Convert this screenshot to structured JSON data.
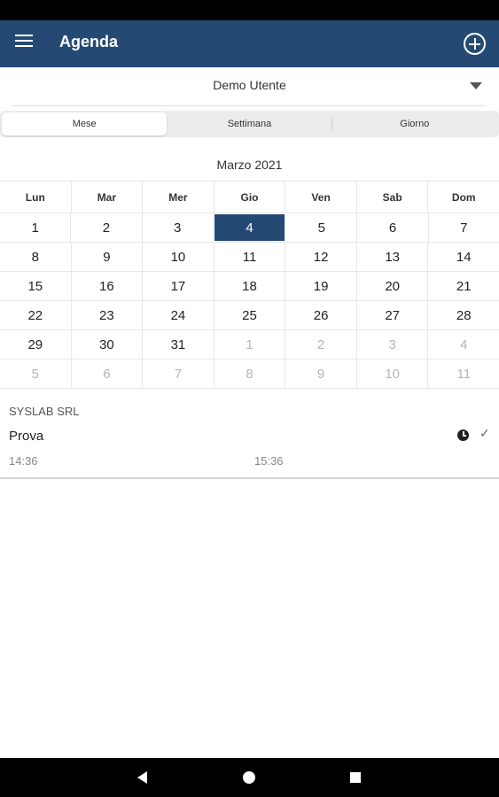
{
  "app": {
    "title": "Agenda",
    "menu_icon": "hamburger-menu-icon",
    "add_icon": "plus-circle-icon"
  },
  "user_selector": {
    "value": "Demo Utente",
    "icon": "triangle-down-icon"
  },
  "view_tabs": [
    {
      "label": "Mese",
      "active": true
    },
    {
      "label": "Settimana",
      "active": false
    },
    {
      "label": "Giorno",
      "active": false
    }
  ],
  "calendar": {
    "month_label": "Marzo 2021",
    "weekdays": [
      "Lun",
      "Mar",
      "Mer",
      "Gio",
      "Ven",
      "Sab",
      "Dom"
    ],
    "weeks": [
      [
        {
          "d": "1",
          "o": false
        },
        {
          "d": "2",
          "o": false
        },
        {
          "d": "3",
          "o": false
        },
        {
          "d": "4",
          "o": false,
          "sel": true
        },
        {
          "d": "5",
          "o": false
        },
        {
          "d": "6",
          "o": false
        },
        {
          "d": "7",
          "o": false
        }
      ],
      [
        {
          "d": "8",
          "o": false
        },
        {
          "d": "9",
          "o": false
        },
        {
          "d": "10",
          "o": false
        },
        {
          "d": "11",
          "o": false
        },
        {
          "d": "12",
          "o": false
        },
        {
          "d": "13",
          "o": false
        },
        {
          "d": "14",
          "o": false
        }
      ],
      [
        {
          "d": "15",
          "o": false
        },
        {
          "d": "16",
          "o": false
        },
        {
          "d": "17",
          "o": false
        },
        {
          "d": "18",
          "o": false
        },
        {
          "d": "19",
          "o": false
        },
        {
          "d": "20",
          "o": false
        },
        {
          "d": "21",
          "o": false
        }
      ],
      [
        {
          "d": "22",
          "o": false
        },
        {
          "d": "23",
          "o": false
        },
        {
          "d": "24",
          "o": false
        },
        {
          "d": "25",
          "o": false
        },
        {
          "d": "26",
          "o": false
        },
        {
          "d": "27",
          "o": false
        },
        {
          "d": "28",
          "o": false
        }
      ],
      [
        {
          "d": "29",
          "o": false
        },
        {
          "d": "30",
          "o": false
        },
        {
          "d": "31",
          "o": false
        },
        {
          "d": "1",
          "o": true
        },
        {
          "d": "2",
          "o": true
        },
        {
          "d": "3",
          "o": true
        },
        {
          "d": "4",
          "o": true
        }
      ],
      [
        {
          "d": "5",
          "o": true
        },
        {
          "d": "6",
          "o": true
        },
        {
          "d": "7",
          "o": true
        },
        {
          "d": "8",
          "o": true
        },
        {
          "d": "9",
          "o": true
        },
        {
          "d": "10",
          "o": true
        },
        {
          "d": "11",
          "o": true
        }
      ]
    ]
  },
  "event": {
    "company": "SYSLAB SRL",
    "name": "Prova",
    "start_time": "14:36",
    "end_time": "15:36",
    "status_icons": [
      "clock-icon",
      "check-icon"
    ]
  },
  "colors": {
    "primary": "#244a73",
    "selected_day": "#244a73"
  }
}
